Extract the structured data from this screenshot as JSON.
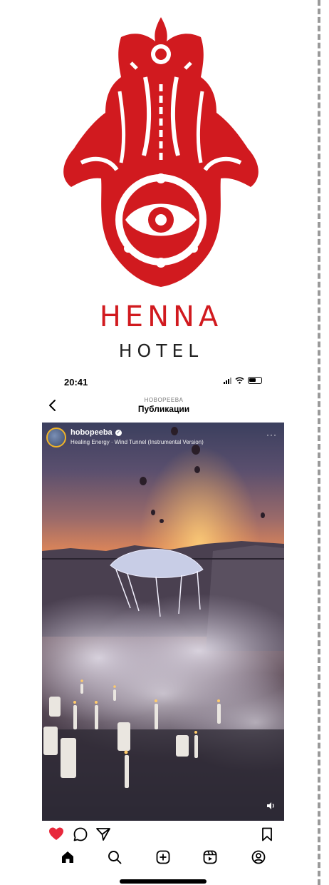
{
  "brand": {
    "line1": "HENNA",
    "line2": "HOTEL",
    "color": "#d11a1f"
  },
  "status_bar": {
    "time": "20:41",
    "icons": [
      "signal-icon",
      "wifi-icon",
      "battery-icon"
    ]
  },
  "header": {
    "subtitle": "HOBOPEEBA",
    "title": "Публикации",
    "back_icon": "chevron-left-icon"
  },
  "post": {
    "author": "hobopeeba",
    "music": "Healing Energy · Wind Tunnel  (Instrumental Version)",
    "more_icon": "more-horizontal-icon",
    "sound_icon": "sound-icon",
    "liked": true
  },
  "actions": {
    "icons": [
      "heart-icon",
      "comment-icon",
      "share-icon",
      "bookmark-icon"
    ]
  },
  "tabbar": {
    "icons": [
      "home-icon",
      "search-icon",
      "create-icon",
      "reels-icon",
      "profile-icon"
    ]
  }
}
